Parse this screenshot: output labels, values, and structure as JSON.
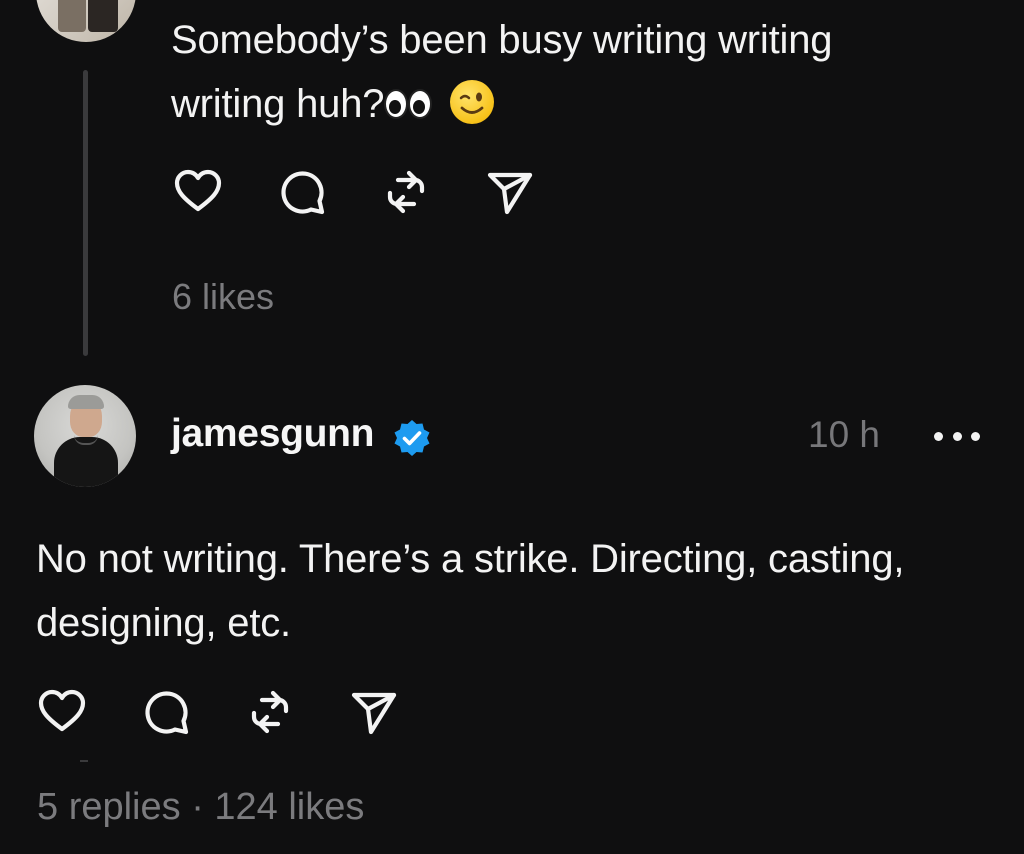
{
  "parent_post": {
    "text": "Somebody’s been busy writing writing writing huh?",
    "emoji_1": "eyes-emoji",
    "emoji_2": "winking-face-emoji",
    "likes": "6 likes"
  },
  "reply": {
    "username": "jamesgunn",
    "verified": true,
    "timestamp": "10 h",
    "text": "No not writing. There’s a strike. Directing, casting, designing, etc.",
    "stats": "5 replies · 124 likes"
  },
  "icons": [
    "heart-icon",
    "comment-icon",
    "repost-icon",
    "share-icon",
    "more-icon",
    "verified-badge-icon"
  ],
  "colors": {
    "background": "#0f0f10",
    "text": "#f3f3f3",
    "muted": "#7b7b7e",
    "verified": "#1d9bf0",
    "thread_line": "#3a3a3c"
  }
}
